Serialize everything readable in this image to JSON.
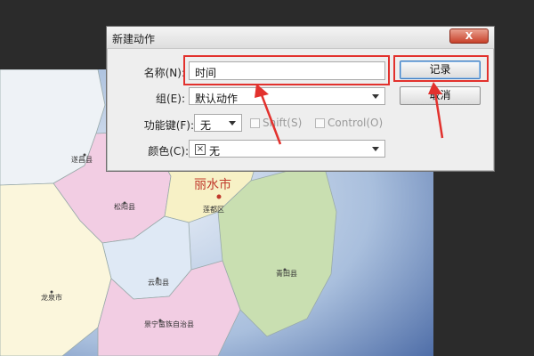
{
  "dialog": {
    "title": "新建动作",
    "close_label": "X",
    "name_label": "名称(N):",
    "name_value": "时间",
    "set_label": "组(E):",
    "set_value": "默认动作",
    "fkey_label": "功能键(F):",
    "fkey_value": "无",
    "shift_label": "Shift(S)",
    "control_label": "Control(O)",
    "color_label": "颜色(C):",
    "color_value": "无",
    "record_label": "记录",
    "cancel_label": "取消"
  },
  "map": {
    "city": "丽水市",
    "places": [
      "遂昌县",
      "松阳县",
      "莲都区",
      "云和县",
      "青田县",
      "龙泉市",
      "景宁畲族自治县"
    ]
  },
  "colors": {
    "annotation": "#e2312d",
    "accent": "#3b7bbf"
  }
}
